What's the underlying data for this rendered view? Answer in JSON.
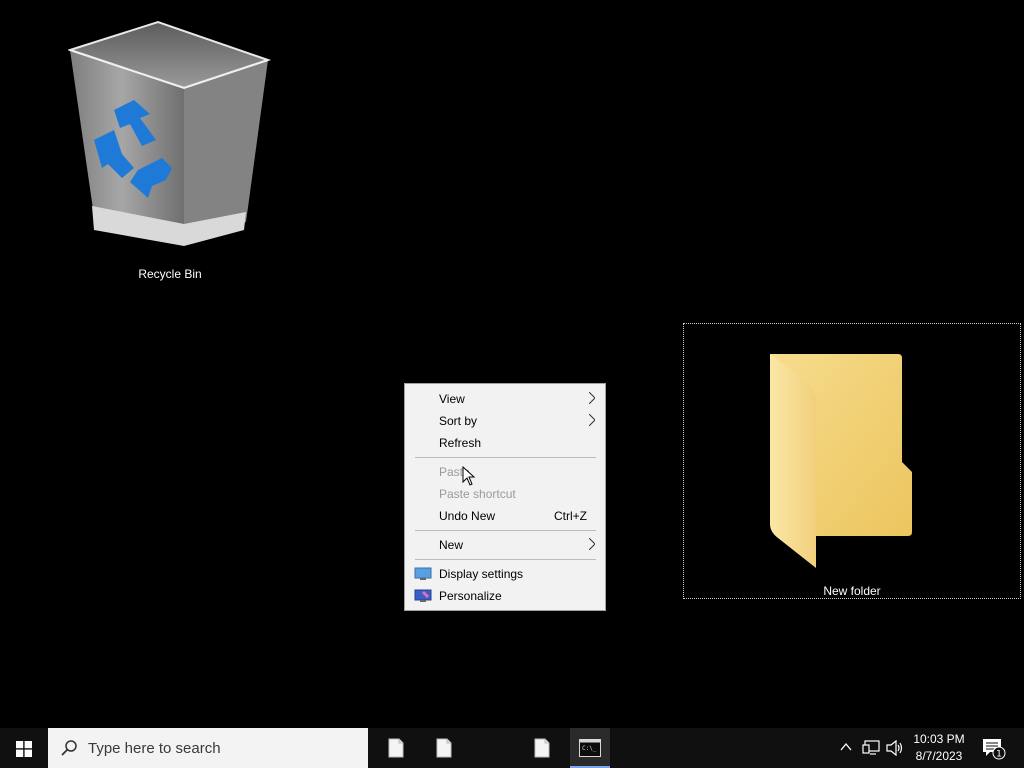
{
  "desktop": {
    "recycle_bin_label": "Recycle Bin",
    "new_folder_label": "New folder"
  },
  "context_menu": {
    "items": [
      {
        "label": "View",
        "submenu": true,
        "enabled": true
      },
      {
        "label": "Sort by",
        "submenu": true,
        "enabled": true
      },
      {
        "label": "Refresh",
        "enabled": true
      },
      {
        "label": "Paste",
        "enabled": false
      },
      {
        "label": "Paste shortcut",
        "enabled": false
      },
      {
        "label": "Undo New",
        "shortcut": "Ctrl+Z",
        "enabled": true
      },
      {
        "label": "New",
        "submenu": true,
        "enabled": true
      },
      {
        "label": "Display settings",
        "icon": "monitor-icon",
        "enabled": true
      },
      {
        "label": "Personalize",
        "icon": "personalize-icon",
        "enabled": true
      }
    ]
  },
  "taskbar": {
    "search_placeholder": "Type here to search",
    "clock_time": "10:03 PM",
    "clock_date": "8/7/2023",
    "notification_count": "1"
  },
  "colors": {
    "desktop_bg": "#000000",
    "menu_bg": "#f2f2f2",
    "taskbar_bg": "#101010",
    "folder_yellow": "#f3d276",
    "accent": "#7aa7e8"
  }
}
